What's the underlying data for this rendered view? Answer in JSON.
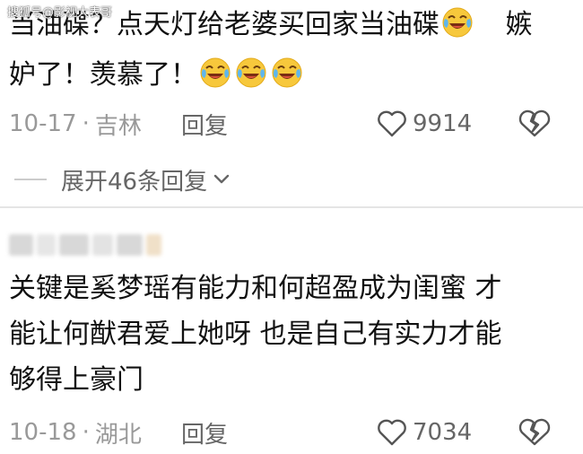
{
  "watermark": "搜狐号@影视大表哥",
  "comment1": {
    "line1": "当油碟？点天灯给老婆买回家当油碟",
    "line1_tail": "嫉",
    "line2": "妒了！羡慕了！",
    "emoji": "crying-laughing-emoji",
    "date": "10-17",
    "separator": "·",
    "location": "吉林",
    "reply_label": "回复",
    "like_count": "9914"
  },
  "expand_replies": {
    "label": "展开46条回复"
  },
  "comment2": {
    "line1": "关键是奚梦瑶有能力和何超盈成为闺蜜 才",
    "line2": "能让何猷君爱上她呀 也是自己有实力才能",
    "line3": "够得上豪门",
    "date": "10-18",
    "separator": "·",
    "location": "湖北",
    "reply_label": "回复",
    "like_count": "7034"
  },
  "colors": {
    "meta_gray": "#999999",
    "text": "#111111",
    "divider": "#e5e5e5"
  }
}
